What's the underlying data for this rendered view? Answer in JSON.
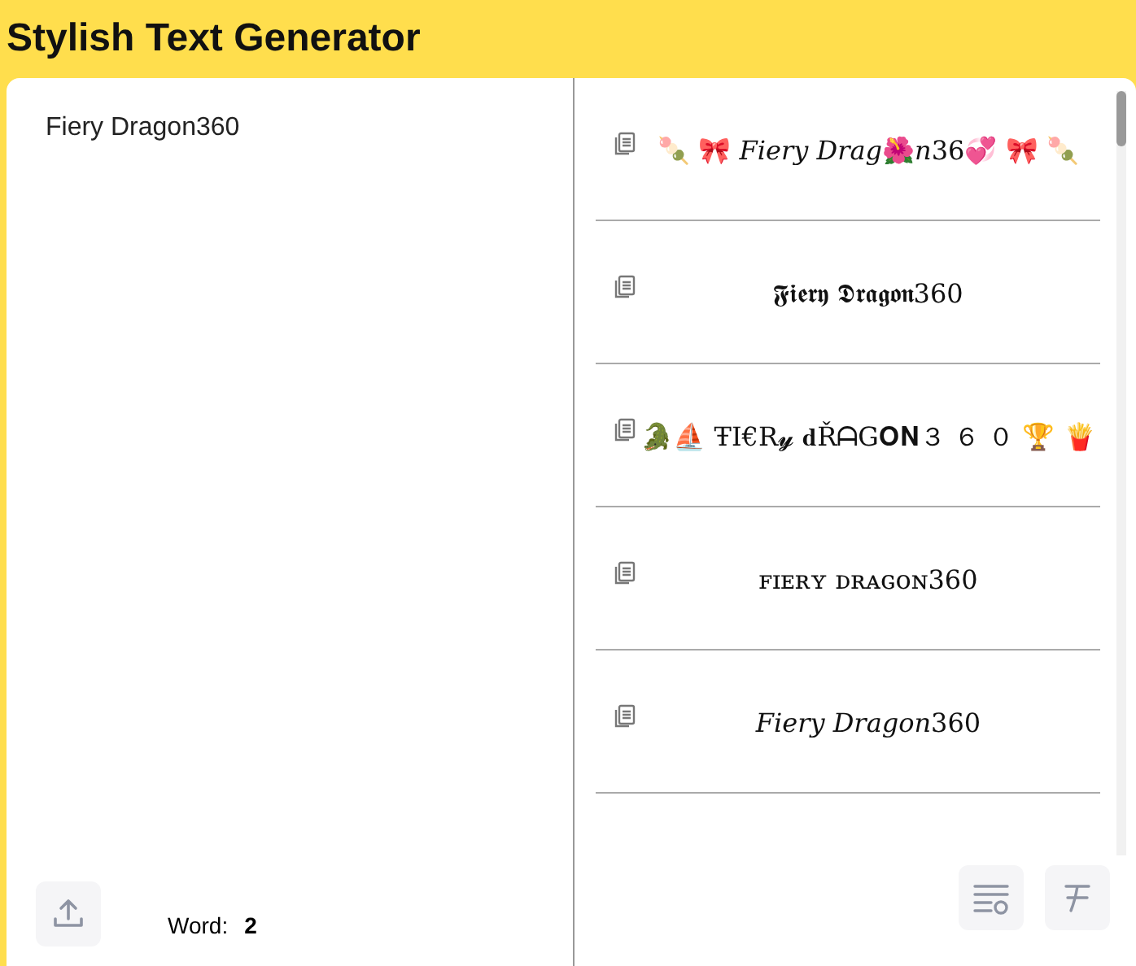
{
  "header": {
    "title": "Stylish Text Generator"
  },
  "input": {
    "value": "Fiery Dragon360"
  },
  "counter": {
    "label": "Word:",
    "value": "2"
  },
  "results": [
    {
      "text": "🍡  🎀  𝐹𝑖𝑒𝑟𝑦 𝐷𝑟𝑎𝑔🌺𝑛36💞  🎀  🍡"
    },
    {
      "text": "𝕱𝖎𝖊𝖗𝖞 𝕯𝖗𝖆𝖌𝖔𝖓360"
    },
    {
      "text": "🐊⛵  ŦI€R𝔂 𝐝ŘᗩG𝐎𝐍３ ６ ０  🏆  🍟"
    },
    {
      "text": "ꜰɪᴇʀʏ ᴅʀᴀɢᴏɴ360"
    },
    {
      "text": "𝐹𝑖𝑒𝑟𝑦 𝐷𝑟𝑎𝑔𝑜𝑛360"
    }
  ]
}
